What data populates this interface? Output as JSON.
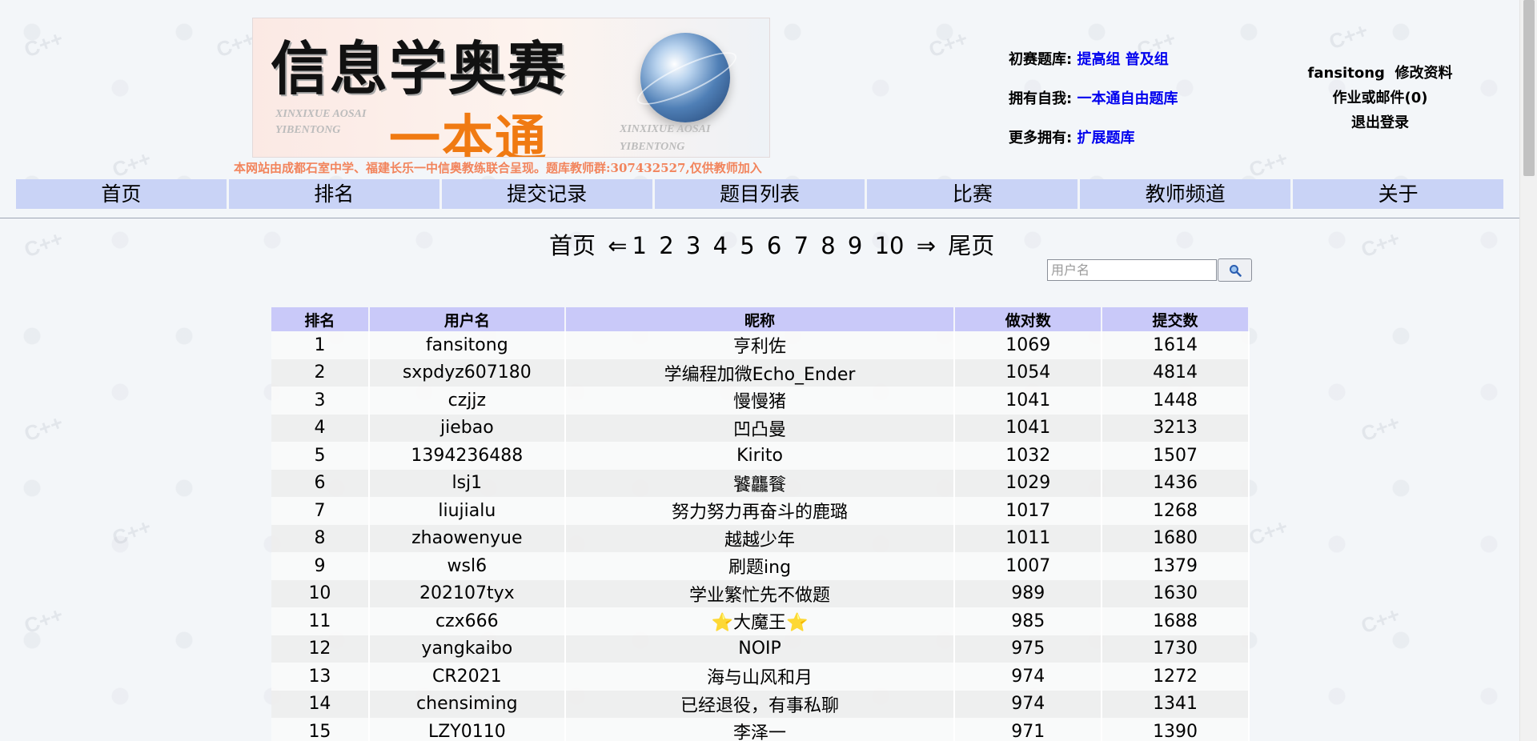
{
  "banner": {
    "title": "信息学奥赛",
    "subtitle": "一本通",
    "pinyin_left": "XINXIXUE AOSAI YIBENTONG",
    "pinyin_right": "XINXIXUE AOSAI YIBENTONG"
  },
  "notice": "本网站由成都石室中学、福建长乐一中信奥教练联合呈现。题库教师群:307432527,仅供教师加入",
  "links": {
    "row1_label": "初赛题库:",
    "row1_link1": "提高组",
    "row1_link2": "普及组",
    "row2_label": "拥有自我:",
    "row2_link1": "一本通自由题库",
    "row3_label": "更多拥有:",
    "row3_link1": "扩展题库"
  },
  "user": {
    "username": "fansitong",
    "edit_profile": "修改资料",
    "mail": "作业或邮件(0)",
    "logout": "退出登录"
  },
  "nav": [
    "首页",
    "排名",
    "提交记录",
    "题目列表",
    "比赛",
    "教师频道",
    "关于"
  ],
  "pager": {
    "first": "首页",
    "prev": "⇐",
    "pages": [
      "1",
      "2",
      "3",
      "4",
      "5",
      "6",
      "7",
      "8",
      "9",
      "10"
    ],
    "next": "⇒",
    "last": "尾页"
  },
  "search": {
    "placeholder": "用户名",
    "icon": "search-icon"
  },
  "table": {
    "headers": [
      "排名",
      "用户名",
      "昵称",
      "做对数",
      "提交数"
    ],
    "rows": [
      [
        "1",
        "fansitong",
        "亨利佐",
        "1069",
        "1614"
      ],
      [
        "2",
        "sxpdyz607180",
        "学编程加微Echo_Ender",
        "1054",
        "4814"
      ],
      [
        "3",
        "czjjz",
        "慢慢猪",
        "1041",
        "1448"
      ],
      [
        "4",
        "jiebao",
        "凹凸曼",
        "1041",
        "3213"
      ],
      [
        "5",
        "1394236488",
        "Kirito",
        "1032",
        "1507"
      ],
      [
        "6",
        "lsj1",
        "饕龘餮",
        "1029",
        "1436"
      ],
      [
        "7",
        "liujialu",
        "努力努力再奋斗的鹿璐",
        "1017",
        "1268"
      ],
      [
        "8",
        "zhaowenyue",
        "越越少年",
        "1011",
        "1680"
      ],
      [
        "9",
        "wsl6",
        "刷题ing",
        "1007",
        "1379"
      ],
      [
        "10",
        "202107tyx",
        "学业繁忙先不做题",
        "989",
        "1630"
      ],
      [
        "11",
        "czx666",
        "⭐大魔王⭐",
        "985",
        "1688"
      ],
      [
        "12",
        "yangkaibo",
        "NOIP",
        "975",
        "1730"
      ],
      [
        "13",
        "CR2021",
        "海与山风和月",
        "974",
        "1272"
      ],
      [
        "14",
        "chensiming",
        "已经退役，有事私聊",
        "974",
        "1341"
      ],
      [
        "15",
        "LZY0110",
        "李泽一",
        "971",
        "1390"
      ]
    ]
  },
  "watermark_text": "C++"
}
